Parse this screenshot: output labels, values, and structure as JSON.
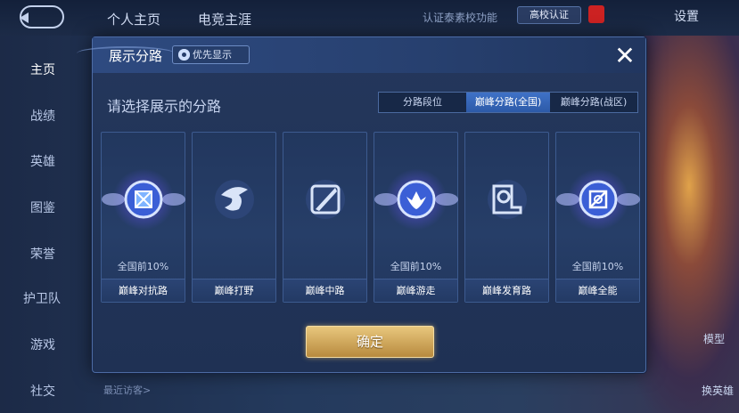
{
  "top_bar": {
    "tabs": [
      "个人主页",
      "电竞主涯"
    ],
    "cert_text": "认证泰素校功能",
    "cert_badge": "高校认证",
    "settings": "设置"
  },
  "left_nav": [
    "主页",
    "战绩",
    "英雄",
    "图鉴",
    "荣誉",
    "护卫队",
    "游戏",
    "社交"
  ],
  "recent_visitors": "最近访客>",
  "right_side": {
    "model": "模型",
    "change_hero": "换英雄"
  },
  "dialog": {
    "title": "展示分路",
    "priority_button": "优先显示",
    "prompt": "请选择展示的分路",
    "tabs": [
      {
        "label": "分路段位",
        "selected": false
      },
      {
        "label": "巅峰分路(全国)",
        "selected": true
      },
      {
        "label": "巅峰分路(战区)",
        "selected": false
      }
    ],
    "cards": [
      {
        "name": "巅峰对抗路",
        "rank": "全国前10%",
        "icon": "clash-lane-icon"
      },
      {
        "name": "巅峰打野",
        "rank": "",
        "icon": "jungle-icon"
      },
      {
        "name": "巅峰中路",
        "rank": "",
        "icon": "mid-lane-icon"
      },
      {
        "name": "巅峰游走",
        "rank": "全国前10%",
        "icon": "roam-icon"
      },
      {
        "name": "巅峰发育路",
        "rank": "",
        "icon": "farm-lane-icon"
      },
      {
        "name": "巅峰全能",
        "rank": "全国前10%",
        "icon": "all-round-icon"
      }
    ],
    "confirm_button": "确定",
    "close_label": "✕"
  }
}
